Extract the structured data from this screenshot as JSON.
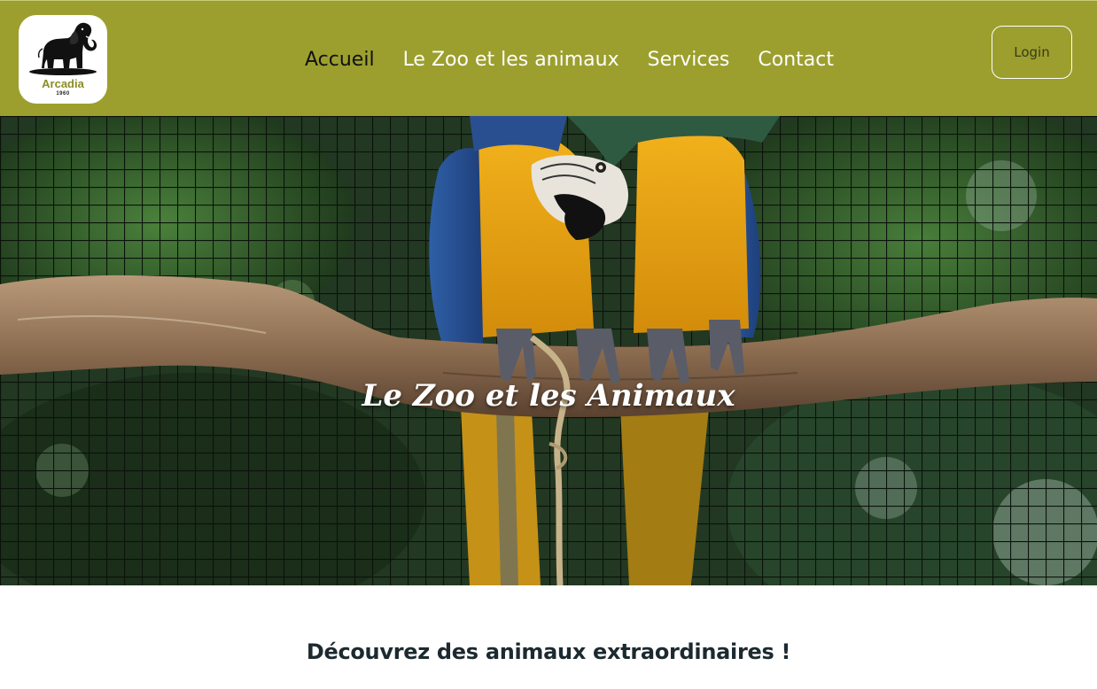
{
  "brand": {
    "name": "Arcadia",
    "year": "1960",
    "icon": "elephant-icon",
    "color": "#9c9f2e"
  },
  "nav": {
    "items": [
      {
        "label": "Accueil",
        "active": true
      },
      {
        "label": "Le Zoo et les animaux",
        "active": false
      },
      {
        "label": "Services",
        "active": false
      },
      {
        "label": "Contact",
        "active": false
      }
    ]
  },
  "header": {
    "login_label": "Login"
  },
  "hero": {
    "title": "Le Zoo et les Animaux"
  },
  "section": {
    "title": "Découvrez des animaux extraordinaires !"
  }
}
